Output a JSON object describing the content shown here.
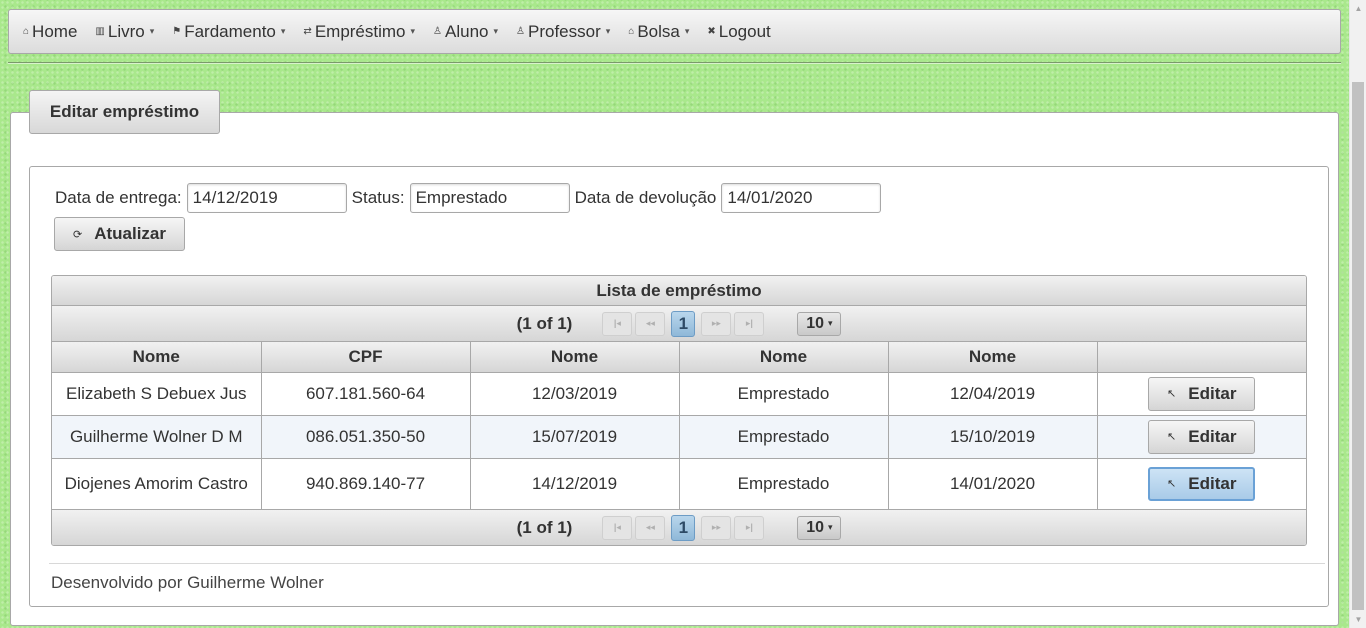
{
  "menu": {
    "items": [
      {
        "icon": "⌂",
        "label": "Home",
        "has_caret": false
      },
      {
        "icon": "▥",
        "label": "Livro",
        "has_caret": true
      },
      {
        "icon": "⚑",
        "label": "Fardamento",
        "has_caret": true
      },
      {
        "icon": "⇄",
        "label": "Empréstimo",
        "has_caret": true
      },
      {
        "icon": "♙",
        "label": "Aluno",
        "has_caret": true
      },
      {
        "icon": "♙",
        "label": "Professor",
        "has_caret": true
      },
      {
        "icon": "⌂",
        "label": "Bolsa",
        "has_caret": true
      },
      {
        "icon": "✖",
        "label": "Logout",
        "has_caret": false
      }
    ],
    "caret": "▾"
  },
  "panel": {
    "title": "Editar empréstimo"
  },
  "form": {
    "entrega_label": "Data de entrega:",
    "entrega_value": "14/12/2019",
    "status_label": "Status:",
    "status_value": "Emprestado",
    "devolucao_label": "Data de devolução",
    "devolucao_value": "14/01/2020",
    "update_label": "Atualizar",
    "update_icon": "⟳"
  },
  "table": {
    "title": "Lista de empréstimo",
    "paginator": {
      "current": "(1 of 1)",
      "first": "|◂",
      "prev": "◂◂",
      "page": "1",
      "next": "▸▸",
      "last": "▸|",
      "rows": "10",
      "dropdown": "▾"
    },
    "columns": [
      "Nome",
      "CPF",
      "Nome",
      "Nome",
      "Nome",
      ""
    ],
    "rows": [
      [
        "Elizabeth S Debuex Jus",
        "607.181.560-64",
        "12/03/2019",
        "Emprestado",
        "12/04/2019"
      ],
      [
        "Guilherme Wolner D M",
        "086.051.350-50",
        "15/07/2019",
        "Emprestado",
        "15/10/2019"
      ],
      [
        "Diojenes Amorim Castro",
        "940.869.140-77",
        "14/12/2019",
        "Emprestado",
        "14/01/2020"
      ]
    ],
    "edit_label": "Editar",
    "edit_icon": "↖"
  },
  "footer": {
    "text": "Desenvolvido por Guilherme Wolner"
  }
}
